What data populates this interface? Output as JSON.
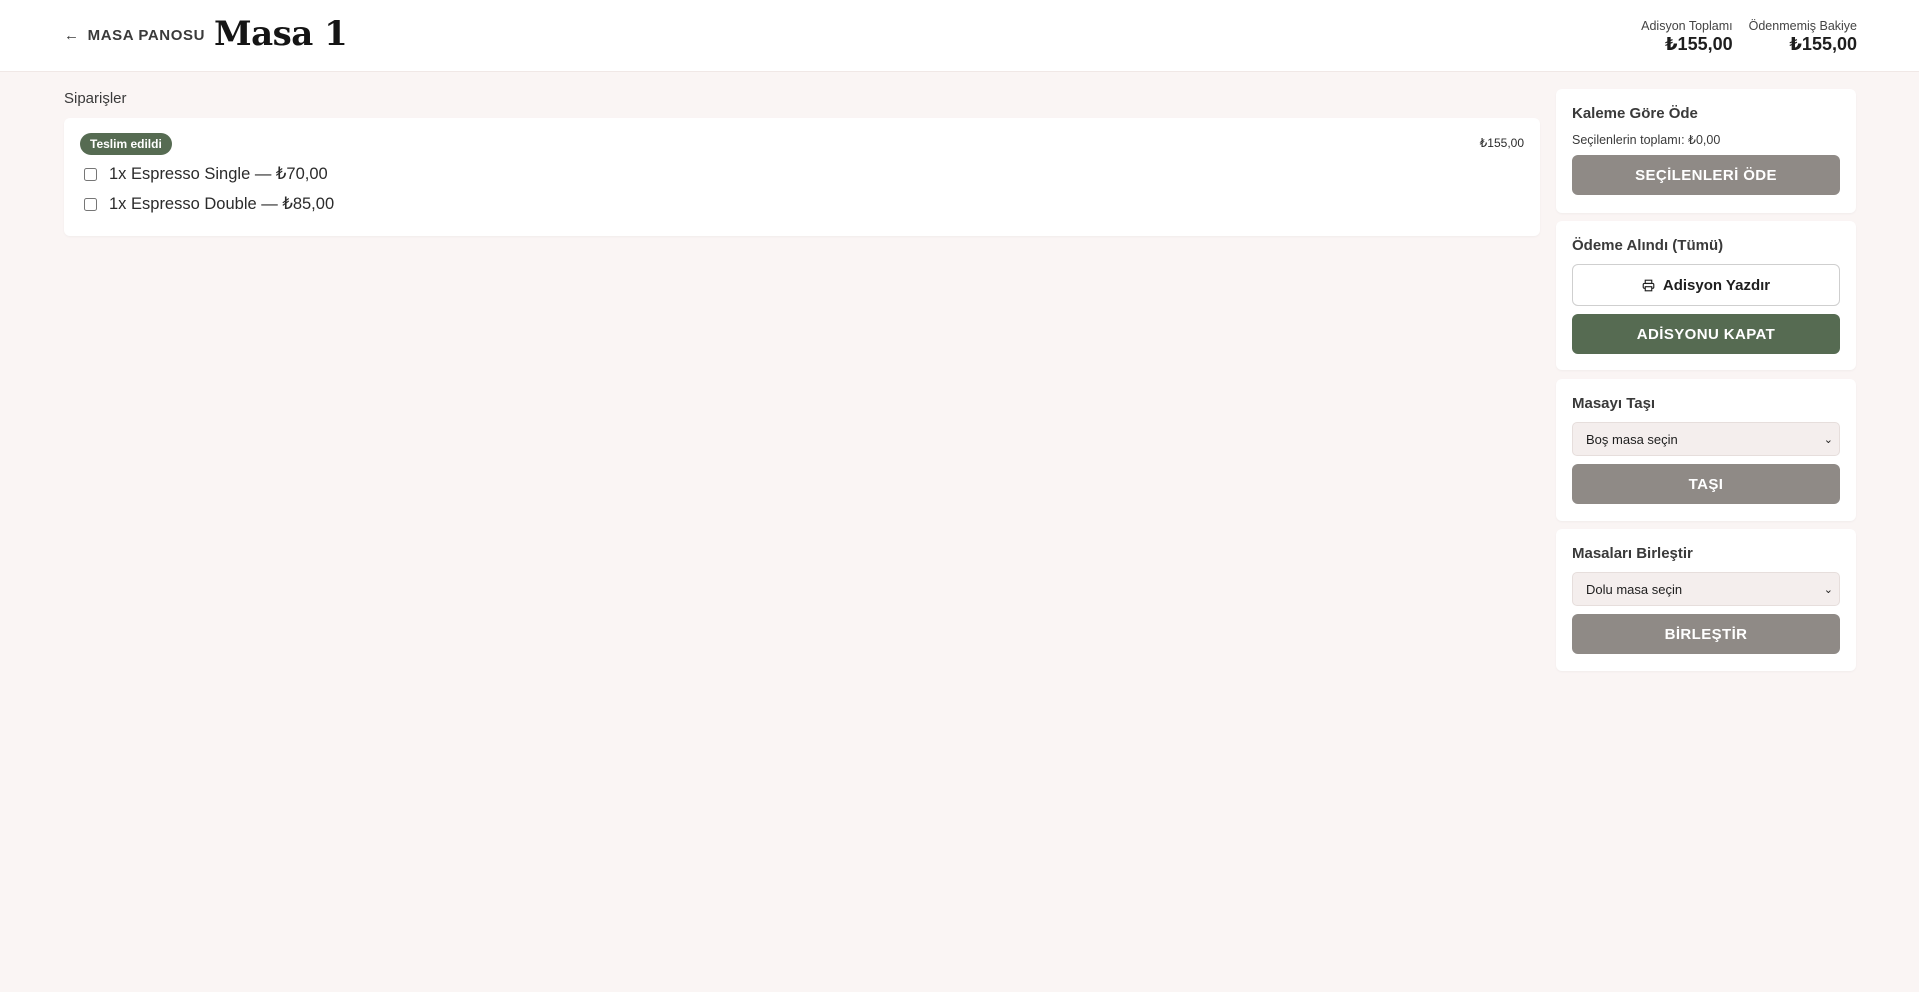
{
  "header": {
    "back_label": "MASA PANOSU",
    "title": "Masa 1",
    "summary": [
      {
        "label": "Adisyon Toplamı",
        "value": "₺155,00"
      },
      {
        "label": "Ödenmemiş Bakiye",
        "value": "₺155,00"
      }
    ]
  },
  "orders": {
    "heading": "Siparişler",
    "card": {
      "status": "Teslim edildi",
      "total": "₺155,00",
      "items": [
        {
          "text": "1x Espresso Single — ₺70,00",
          "checked": false
        },
        {
          "text": "1x Espresso Double — ₺85,00",
          "checked": false
        }
      ]
    }
  },
  "sidebar": {
    "pay_by_item": {
      "title": "Kaleme Göre Öde",
      "selected_total": "Seçilenlerin toplamı: ₺0,00",
      "button": "SEÇİLENLERİ ÖDE"
    },
    "payment_received": {
      "title": "Ödeme Alındı (Tümü)",
      "print_button": "Adisyon Yazdır",
      "close_button": "ADİSYONU KAPAT"
    },
    "move_table": {
      "title": "Masayı Taşı",
      "select_value": "Boş masa seçin",
      "button": "TAŞI"
    },
    "merge_tables": {
      "title": "Masaları Birleştir",
      "select_value": "Dolu masa seçin",
      "button": "BİRLEŞTİR"
    }
  },
  "colors": {
    "background": "#faf5f4",
    "accent_green": "#566b52",
    "disabled_grey": "#8f8a86"
  },
  "icons": [
    "arrow-left-icon",
    "printer-icon",
    "chevron-down-icon"
  ]
}
